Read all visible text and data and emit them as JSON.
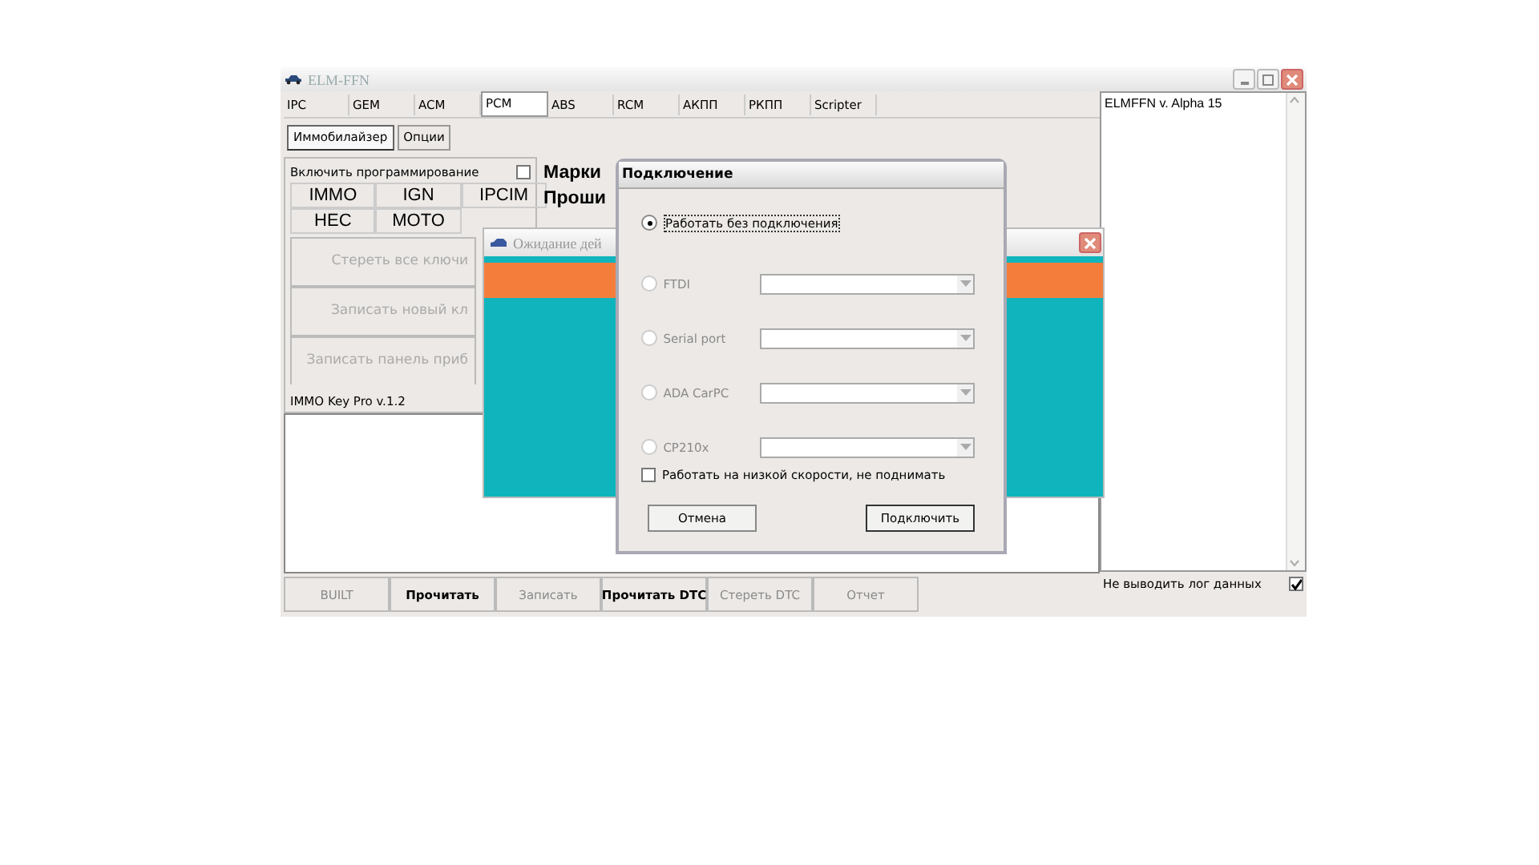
{
  "main_window": {
    "title": "ELM-FFN",
    "tabs": [
      {
        "label": "IPC",
        "selected": false
      },
      {
        "label": "GEM",
        "selected": false
      },
      {
        "label": "ACM",
        "selected": false
      },
      {
        "label": "PCM",
        "selected": true
      },
      {
        "label": "ABS",
        "selected": false
      },
      {
        "label": "RCM",
        "selected": false
      },
      {
        "label": "АКПП",
        "selected": false
      },
      {
        "label": "РКПП",
        "selected": false
      },
      {
        "label": "Scripter",
        "selected": false
      }
    ],
    "subtabs": [
      {
        "label": "Иммобилайзер",
        "selected": true
      },
      {
        "label": "Опции",
        "selected": false
      }
    ],
    "immo_panel": {
      "enable_checkbox": {
        "label": "Включить программирование",
        "checked": false
      },
      "modules": [
        "IMMO",
        "IGN",
        "IPCIM",
        "HEC",
        "MOTO"
      ],
      "actions": [
        "Стереть все ключи",
        "Записать новый кл",
        "Записать панель приб"
      ],
      "version": "IMMO Key Pro v.1.2"
    },
    "info_labels": [
      "Марки",
      "Проши"
    ],
    "bottom_buttons": [
      {
        "label": "BUILT",
        "disabled": true
      },
      {
        "label": "Прочитать",
        "disabled": false
      },
      {
        "label": "Записать",
        "disabled": true
      },
      {
        "label": "Прочитать DTC",
        "disabled": false
      },
      {
        "label": "Стереть DTC",
        "disabled": true
      },
      {
        "label": "Отчет",
        "disabled": true
      }
    ],
    "log_panel": {
      "text": "ELMFFN v. Alpha 15",
      "options": [
        {
          "label": "Не выводить лог данных",
          "checked": true
        }
      ]
    }
  },
  "waiting_window": {
    "title": "Ожидание дей"
  },
  "connect_dialog": {
    "title": "Подключение",
    "options": [
      {
        "label": "Работать без подключения",
        "selected": true,
        "disabled": false,
        "has_combo": false
      },
      {
        "label": "FTDI",
        "selected": false,
        "disabled": true,
        "has_combo": true
      },
      {
        "label": "Serial port",
        "selected": false,
        "disabled": true,
        "has_combo": true
      },
      {
        "label": "ADA CarPC",
        "selected": false,
        "disabled": true,
        "has_combo": true
      },
      {
        "label": "CP210x",
        "selected": false,
        "disabled": true,
        "has_combo": true
      }
    ],
    "low_speed": {
      "label": "Работать на низкой скорости, не поднимать",
      "checked": false
    },
    "buttons": [
      "Отмена",
      "Подключить"
    ]
  }
}
